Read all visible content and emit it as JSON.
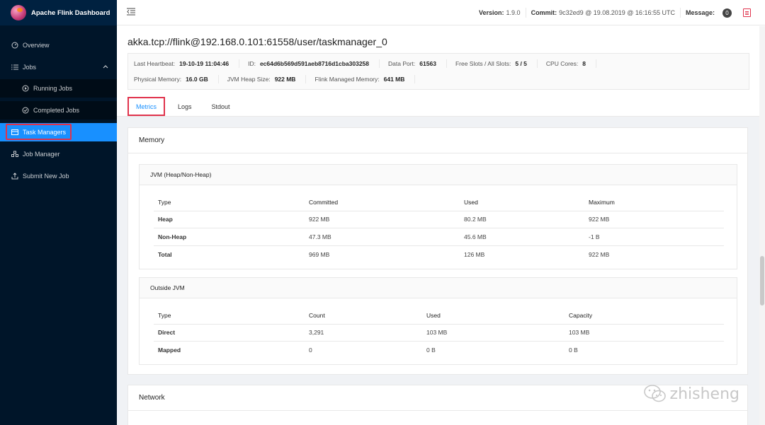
{
  "brand": {
    "title": "Apache Flink Dashboard"
  },
  "sidebar": {
    "items": [
      {
        "label": "Overview",
        "icon": "dashboard-icon"
      },
      {
        "label": "Jobs",
        "icon": "list-icon"
      },
      {
        "label": "Running Jobs",
        "icon": "play-circle-icon"
      },
      {
        "label": "Completed Jobs",
        "icon": "check-circle-icon"
      },
      {
        "label": "Task Managers",
        "icon": "schedule-icon"
      },
      {
        "label": "Job Manager",
        "icon": "cluster-icon"
      },
      {
        "label": "Submit New Job",
        "icon": "upload-icon"
      }
    ]
  },
  "header": {
    "version_label": "Version:",
    "version": "1.9.0",
    "commit_label": "Commit:",
    "commit": "9c32ed9 @ 19.08.2019 @ 16:16:55 UTC",
    "message_label": "Message:",
    "message_count": "0"
  },
  "page": {
    "title": "akka.tcp://flink@192.168.0.101:61558/user/taskmanager_0"
  },
  "info": {
    "last_heartbeat_label": "Last Heartbeat:",
    "last_heartbeat": "19-10-19 11:04:46",
    "id_label": "ID:",
    "id": "ec64d6b569d591aeb8716d1cba303258",
    "data_port_label": "Data Port:",
    "data_port": "61563",
    "slots_label": "Free Slots / All Slots:",
    "slots": "5 / 5",
    "cpu_label": "CPU Cores:",
    "cpu": "8",
    "physical_mem_label": "Physical Memory:",
    "physical_mem": "16.0 GB",
    "jvm_heap_label": "JVM Heap Size:",
    "jvm_heap": "922 MB",
    "managed_mem_label": "Flink Managed Memory:",
    "managed_mem": "641 MB"
  },
  "tabs": [
    {
      "label": "Metrics"
    },
    {
      "label": "Logs"
    },
    {
      "label": "Stdout"
    }
  ],
  "memory": {
    "title": "Memory",
    "jvm": {
      "title": "JVM (Heap/Non-Heap)",
      "headers": [
        "Type",
        "Committed",
        "Used",
        "Maximum"
      ],
      "rows": [
        [
          "Heap",
          "922 MB",
          "80.2 MB",
          "922 MB"
        ],
        [
          "Non-Heap",
          "47.3 MB",
          "45.6 MB",
          "-1 B"
        ],
        [
          "Total",
          "969 MB",
          "126 MB",
          "922 MB"
        ]
      ]
    },
    "outside": {
      "title": "Outside JVM",
      "headers": [
        "Type",
        "Count",
        "Used",
        "Capacity"
      ],
      "rows": [
        [
          "Direct",
          "3,291",
          "103 MB",
          "103 MB"
        ],
        [
          "Mapped",
          "0",
          "0 B",
          "0 B"
        ]
      ]
    }
  },
  "network": {
    "title": "Network"
  },
  "watermark": {
    "text": "zhisheng"
  }
}
